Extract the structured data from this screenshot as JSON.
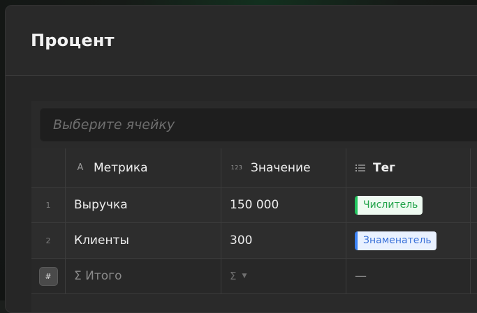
{
  "panel": {
    "title": "Процент"
  },
  "search": {
    "placeholder": "Выберите ячейку",
    "value": ""
  },
  "columns": [
    {
      "label": "Метрика",
      "type_icon": "text-type-icon",
      "type_glyph": "A"
    },
    {
      "label": "Значение",
      "type_icon": "number-type-icon",
      "type_glyph": "123"
    },
    {
      "label": "Тег",
      "type_icon": "list-type-icon"
    }
  ],
  "rows": [
    {
      "num": "1",
      "metric": "Выручка",
      "value": "150 000",
      "tag": "Числитель",
      "tag_color": "#22c55e"
    },
    {
      "num": "2",
      "metric": "Клиенты",
      "value": "300",
      "tag": "Знаменатель",
      "tag_color": "#3b82f6"
    }
  ],
  "total_row": {
    "button_label": "#",
    "label": "Σ Итого",
    "aggregate": "Σ",
    "tag_placeholder": "—"
  }
}
